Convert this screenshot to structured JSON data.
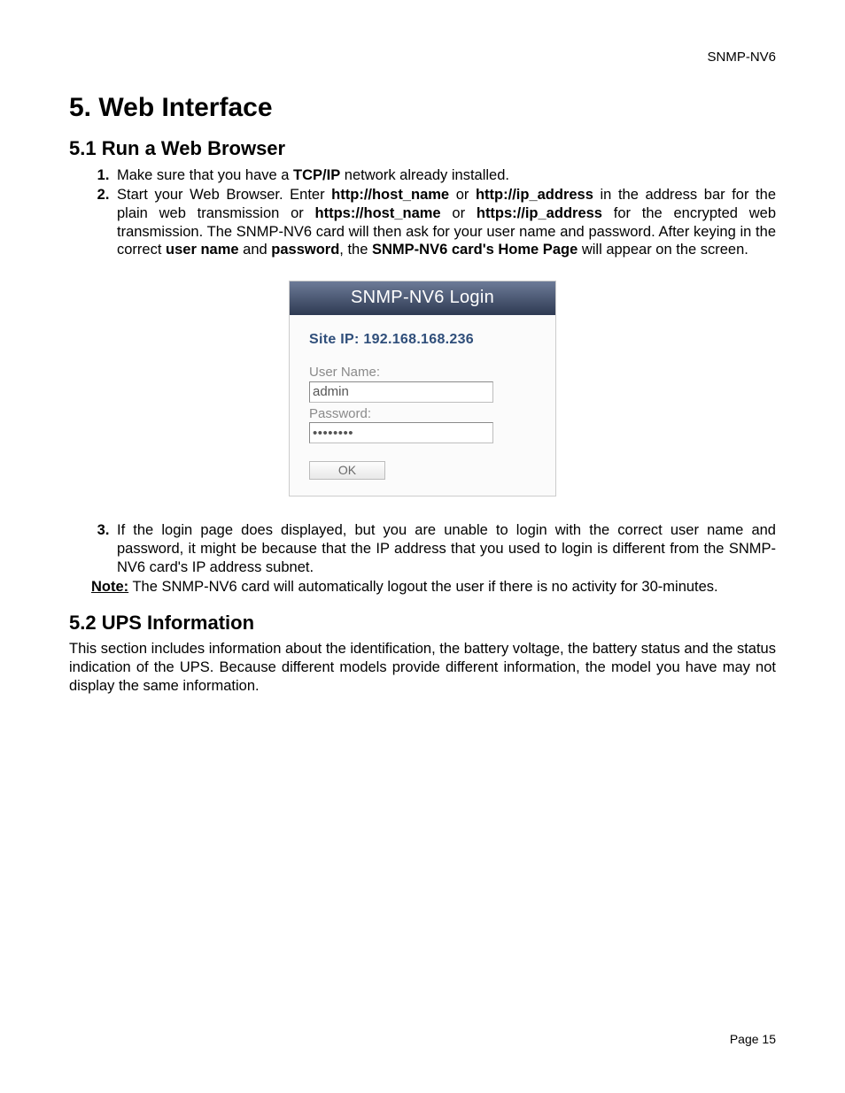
{
  "header": {
    "doc_id": "SNMP-NV6"
  },
  "h1": "5. Web Interface",
  "sec51_title": "5.1 Run a Web Browser",
  "step1": {
    "pre": "Make sure that you have a ",
    "b1": "TCP/IP",
    "post": " network already installed."
  },
  "step2": {
    "p1a": "Start your Web Browser. Enter ",
    "b1": "http://host_name",
    "p1b": " or ",
    "b2": "http://ip_address",
    "p1c": " in the address bar for the plain web transmission or ",
    "b3": "https://host_name",
    "p1d": " or ",
    "b4": "https://ip_address",
    "p1e": " for the encrypted web transmission. The SNMP-NV6 card will then ask for your user name and password. After keying in the correct ",
    "b5": "user name",
    "p1f": " and ",
    "b6": "password",
    "p1g": ", the ",
    "b7": "SNMP-NV6 card's Home Page",
    "p1h": " will appear on the screen."
  },
  "login": {
    "title": "SNMP-NV6 Login",
    "site_ip": "Site IP: 192.168.168.236",
    "user_label": "User Name:",
    "user_value": "admin",
    "pw_label": "Password:",
    "pw_value": "••••••••",
    "ok": "OK"
  },
  "step3": "If the login page does displayed, but you are unable to login with the correct user name and password, it might be because that the IP address that you used to login is different from the SNMP-NV6 card's IP address subnet.",
  "note": {
    "label": "Note:",
    "text": " The SNMP-NV6 card will automatically logout the user if there is no activity for 30-minutes."
  },
  "sec52_title": "5.2 UPS Information",
  "sec52_body": "This section includes information about the identification, the battery voltage, the battery status and the status indication of the UPS. Because different models provide different information, the model you have may not display the same information.",
  "footer": "Page 15"
}
